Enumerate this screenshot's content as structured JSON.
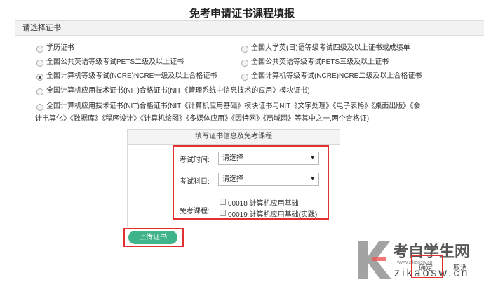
{
  "page": {
    "title": "免考申请证书课程填报"
  },
  "cert_panel": {
    "header": "请选择证书",
    "options": [
      {
        "label": "学历证书",
        "checked": false
      },
      {
        "label": "全国大学英(日)语等级考试四级及以上证书或成绩单",
        "checked": false
      },
      {
        "label": "全国公共英语等级考试PETS二级及以上证书",
        "checked": false
      },
      {
        "label": "全国公共英语等级考试PETS三级及以上证书",
        "checked": false
      },
      {
        "label": "全国计算机等级考试(NCRE)NCRE一级及以上合格证书",
        "checked": true
      },
      {
        "label": "全国计算机等级考试(NCRE)NCRE二级及以上合格证书",
        "checked": false
      },
      {
        "label": "全国计算机应用技术证书(NIT)合格证书(NIT《管理系统中信息技术的应用》模块证书)",
        "checked": false
      },
      {
        "label_line1": "全国计算机应用技术证书(NIT)合格证书(NIT《计算机应用基础》模块证书与NIT《文字处理》《电子表格》《桌面出版》《会",
        "label_line2": "计电算化》《数据库》《程序设计》《计算机绘图》《多媒体应用》《因特网》《局域网》等其中之一,两个合格证)",
        "checked": false
      }
    ]
  },
  "exam_form": {
    "header": "填写证书信息及免考课程",
    "exam_time_label": "考试时间:",
    "exam_time_value": "请选择",
    "exam_subject_label": "考试科目:",
    "exam_subject_value": "请选择",
    "course_label": "免考课程:",
    "courses": [
      {
        "label": "00018 计算机应用基础",
        "checked": false
      },
      {
        "label": "00019 计算机应用基础(实践)",
        "checked": false
      }
    ]
  },
  "upload_button": "上传证书",
  "footer": {
    "confirm": "确定",
    "cancel": "取消"
  },
  "watermark": {
    "brand": "考自学生网",
    "url": "www.zikaosw.cn",
    "sub": "zikaosw.cn"
  },
  "colors": {
    "accent_green": "#3fb48a",
    "highlight_red": "#e03030"
  }
}
